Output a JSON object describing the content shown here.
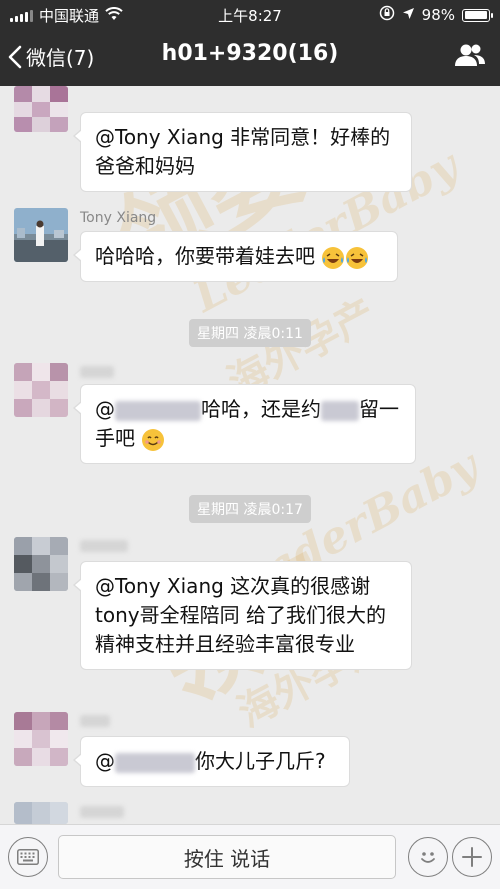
{
  "status_bar": {
    "carrier": "中国联通",
    "time": "上午8:27",
    "battery": "98%",
    "battery_level": 0.98
  },
  "nav": {
    "back_label": "微信(7)",
    "title": "h01+9320(16)",
    "contacts_icon": "group-icon"
  },
  "messages": [
    {
      "sender": "",
      "text": "@Tony Xiang 非常同意！好棒的爸爸和妈妈"
    },
    {
      "sender": "Tony Xiang",
      "text": "哈哈哈，你要带着娃去吧",
      "emoji": [
        "crying-laughing-emoji",
        "crying-laughing-emoji"
      ]
    },
    {
      "timestamp": "星期四 凌晨0:11"
    },
    {
      "sender": "",
      "text_before": "@",
      "text_mid": "哈哈，还是约",
      "text_after": "留一手吧",
      "emoji": [
        "smile-emoji"
      ]
    },
    {
      "timestamp": "星期四 凌晨0:17"
    },
    {
      "sender": "",
      "text": "@Tony Xiang 这次真的很感谢tony哥全程陪同 给了我们很大的精神支柱并且经验丰富很专业"
    },
    {
      "sender": "",
      "text_before": "@",
      "text_after": "你大儿子几斤?"
    }
  ],
  "bottom_bar": {
    "keyboard_icon": "keyboard-icon",
    "hold_to_talk": "按住 说话",
    "emoji_icon": "emoji-icon",
    "plus_icon": "plus-icon"
  },
  "colors": {
    "nav_bg": "#2e2e2e",
    "chat_bg": "#ebebeb",
    "bubble_bg": "#ffffff"
  }
}
